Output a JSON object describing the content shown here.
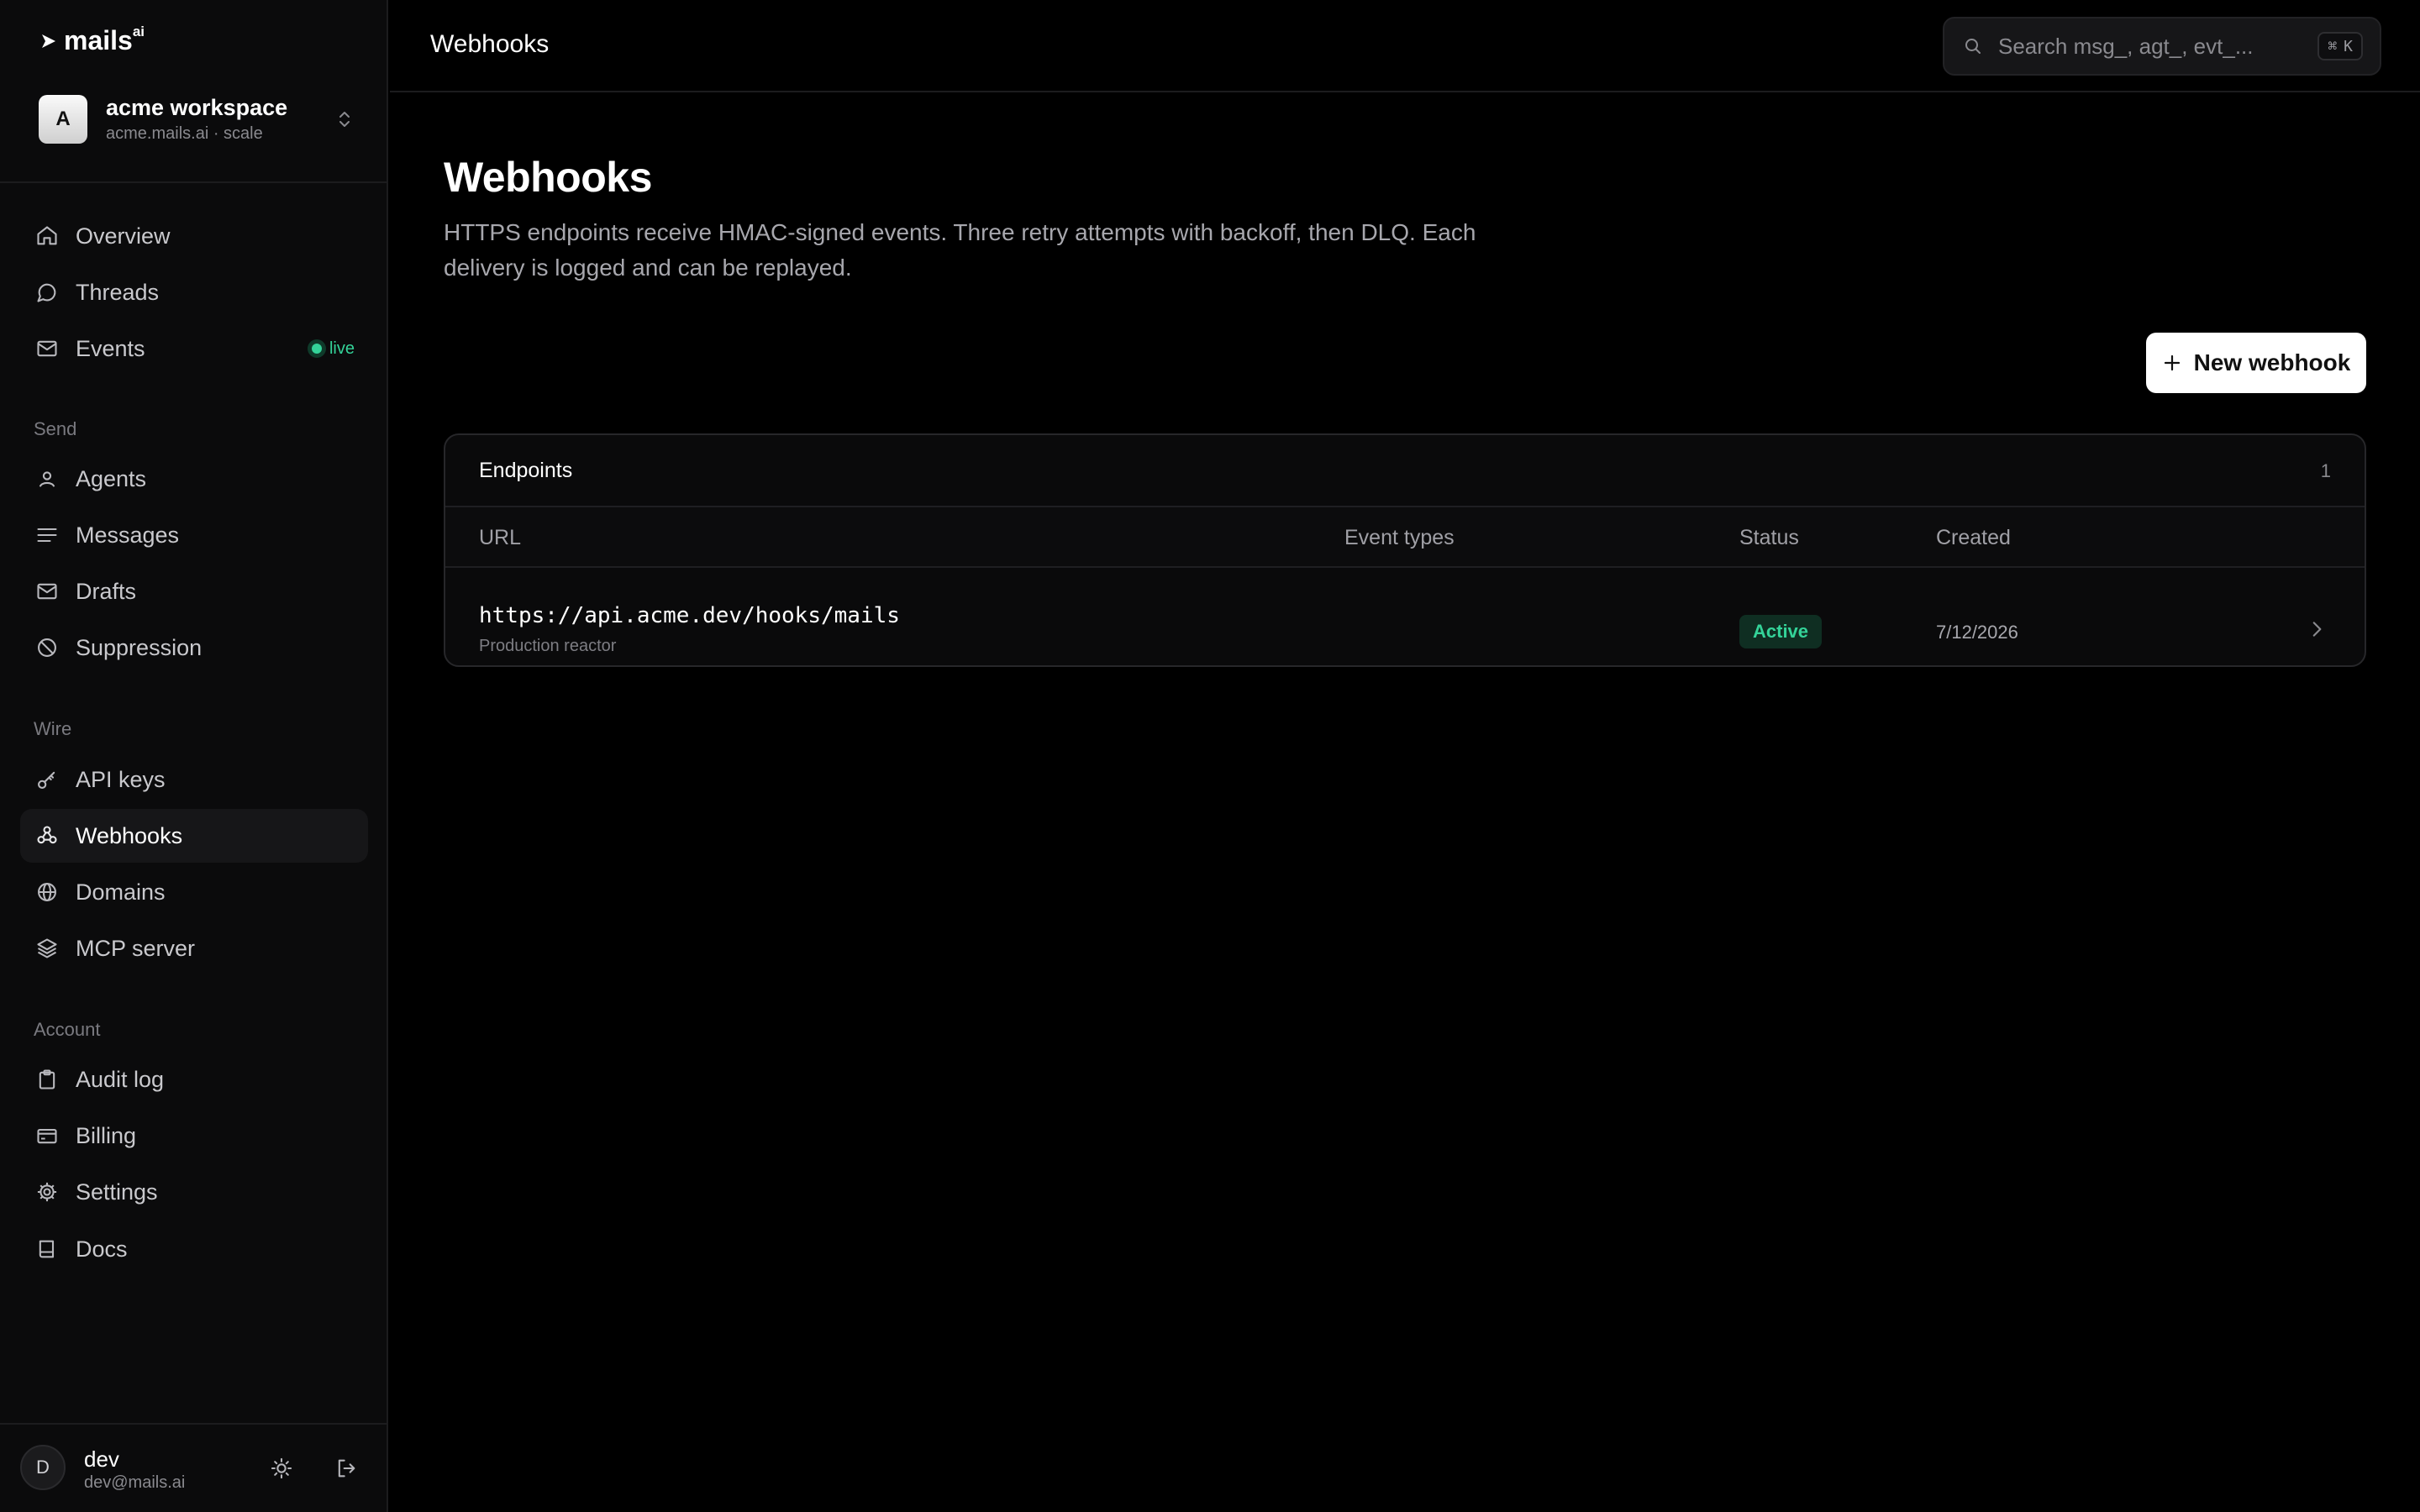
{
  "app": {
    "brand": "mails",
    "brand_sup": "ai",
    "workspace_initial": "A",
    "workspace_name": "acme workspace",
    "workspace_sub": "acme.mails.ai · scale"
  },
  "sidebar": {
    "nav": [
      {
        "label": "Overview",
        "icon": "home-icon"
      },
      {
        "label": "Threads",
        "icon": "chat-bubble-icon"
      },
      {
        "label": "Events",
        "icon": "inbox-icon",
        "badge": "live"
      }
    ],
    "sections": [
      {
        "label": "Send",
        "items": [
          {
            "label": "Agents",
            "icon": "user-icon"
          },
          {
            "label": "Messages",
            "icon": "lines-icon"
          },
          {
            "label": "Drafts",
            "icon": "mail-draft-icon"
          },
          {
            "label": "Suppression",
            "icon": "ban-icon"
          }
        ]
      },
      {
        "label": "Wire",
        "items": [
          {
            "label": "API keys",
            "icon": "key-icon"
          },
          {
            "label": "Webhooks",
            "icon": "webhook-icon",
            "active": true
          },
          {
            "label": "Domains",
            "icon": "globe-icon"
          },
          {
            "label": "MCP server",
            "icon": "layers-icon"
          }
        ]
      },
      {
        "label": "Account",
        "items": [
          {
            "label": "Audit log",
            "icon": "clipboard-icon"
          },
          {
            "label": "Billing",
            "icon": "credit-card-icon"
          },
          {
            "label": "Settings",
            "icon": "gear-icon"
          },
          {
            "label": "Docs",
            "icon": "book-icon"
          }
        ]
      }
    ],
    "user": {
      "initial": "D",
      "name": "dev",
      "email": "dev@mails.ai"
    }
  },
  "topbar": {
    "title": "Webhooks",
    "search_placeholder": "Search msg_, agt_, evt_...",
    "shortcut_symbol": "⌘",
    "shortcut_key": "K"
  },
  "page": {
    "title": "Webhooks",
    "description": "HTTPS endpoints receive HMAC-signed events. Three retry attempts with backoff, then DLQ. Each delivery is logged and can be replayed.",
    "new_button": "New webhook"
  },
  "endpoints": {
    "title": "Endpoints",
    "count": "1",
    "columns": [
      "URL",
      "Event types",
      "Status",
      "Created"
    ],
    "rows": [
      {
        "url": "https://api.acme.dev/hooks/mails",
        "description": "Production reactor",
        "event_types": "",
        "status": "Active",
        "created": "7/12/2026"
      }
    ]
  },
  "colors": {
    "accent": "#34d399",
    "background": "#000000",
    "sidebar": "#0b0b0c"
  }
}
